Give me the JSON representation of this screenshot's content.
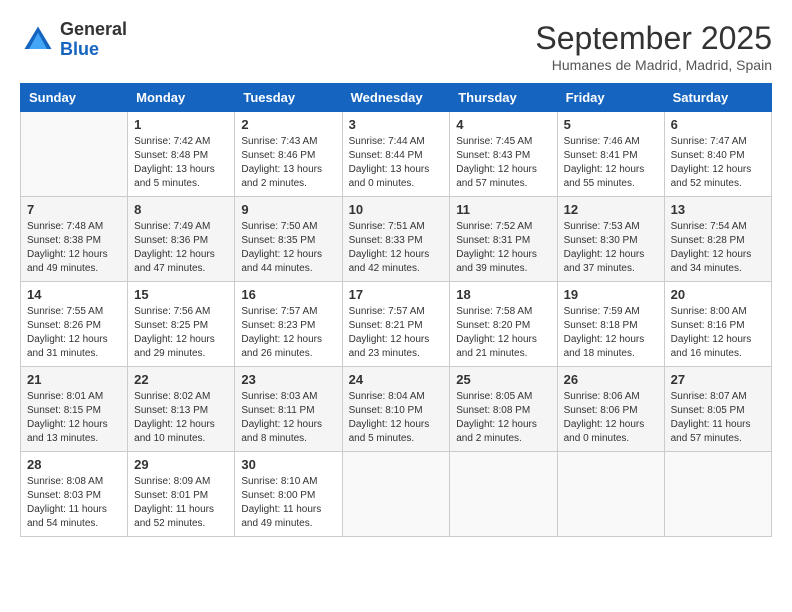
{
  "header": {
    "logo_line1": "General",
    "logo_line2": "Blue",
    "month_title": "September 2025",
    "location": "Humanes de Madrid, Madrid, Spain"
  },
  "days_of_week": [
    "Sunday",
    "Monday",
    "Tuesday",
    "Wednesday",
    "Thursday",
    "Friday",
    "Saturday"
  ],
  "weeks": [
    [
      {
        "day": "",
        "info": ""
      },
      {
        "day": "1",
        "info": "Sunrise: 7:42 AM\nSunset: 8:48 PM\nDaylight: 13 hours\nand 5 minutes."
      },
      {
        "day": "2",
        "info": "Sunrise: 7:43 AM\nSunset: 8:46 PM\nDaylight: 13 hours\nand 2 minutes."
      },
      {
        "day": "3",
        "info": "Sunrise: 7:44 AM\nSunset: 8:44 PM\nDaylight: 13 hours\nand 0 minutes."
      },
      {
        "day": "4",
        "info": "Sunrise: 7:45 AM\nSunset: 8:43 PM\nDaylight: 12 hours\nand 57 minutes."
      },
      {
        "day": "5",
        "info": "Sunrise: 7:46 AM\nSunset: 8:41 PM\nDaylight: 12 hours\nand 55 minutes."
      },
      {
        "day": "6",
        "info": "Sunrise: 7:47 AM\nSunset: 8:40 PM\nDaylight: 12 hours\nand 52 minutes."
      }
    ],
    [
      {
        "day": "7",
        "info": "Sunrise: 7:48 AM\nSunset: 8:38 PM\nDaylight: 12 hours\nand 49 minutes."
      },
      {
        "day": "8",
        "info": "Sunrise: 7:49 AM\nSunset: 8:36 PM\nDaylight: 12 hours\nand 47 minutes."
      },
      {
        "day": "9",
        "info": "Sunrise: 7:50 AM\nSunset: 8:35 PM\nDaylight: 12 hours\nand 44 minutes."
      },
      {
        "day": "10",
        "info": "Sunrise: 7:51 AM\nSunset: 8:33 PM\nDaylight: 12 hours\nand 42 minutes."
      },
      {
        "day": "11",
        "info": "Sunrise: 7:52 AM\nSunset: 8:31 PM\nDaylight: 12 hours\nand 39 minutes."
      },
      {
        "day": "12",
        "info": "Sunrise: 7:53 AM\nSunset: 8:30 PM\nDaylight: 12 hours\nand 37 minutes."
      },
      {
        "day": "13",
        "info": "Sunrise: 7:54 AM\nSunset: 8:28 PM\nDaylight: 12 hours\nand 34 minutes."
      }
    ],
    [
      {
        "day": "14",
        "info": "Sunrise: 7:55 AM\nSunset: 8:26 PM\nDaylight: 12 hours\nand 31 minutes."
      },
      {
        "day": "15",
        "info": "Sunrise: 7:56 AM\nSunset: 8:25 PM\nDaylight: 12 hours\nand 29 minutes."
      },
      {
        "day": "16",
        "info": "Sunrise: 7:57 AM\nSunset: 8:23 PM\nDaylight: 12 hours\nand 26 minutes."
      },
      {
        "day": "17",
        "info": "Sunrise: 7:57 AM\nSunset: 8:21 PM\nDaylight: 12 hours\nand 23 minutes."
      },
      {
        "day": "18",
        "info": "Sunrise: 7:58 AM\nSunset: 8:20 PM\nDaylight: 12 hours\nand 21 minutes."
      },
      {
        "day": "19",
        "info": "Sunrise: 7:59 AM\nSunset: 8:18 PM\nDaylight: 12 hours\nand 18 minutes."
      },
      {
        "day": "20",
        "info": "Sunrise: 8:00 AM\nSunset: 8:16 PM\nDaylight: 12 hours\nand 16 minutes."
      }
    ],
    [
      {
        "day": "21",
        "info": "Sunrise: 8:01 AM\nSunset: 8:15 PM\nDaylight: 12 hours\nand 13 minutes."
      },
      {
        "day": "22",
        "info": "Sunrise: 8:02 AM\nSunset: 8:13 PM\nDaylight: 12 hours\nand 10 minutes."
      },
      {
        "day": "23",
        "info": "Sunrise: 8:03 AM\nSunset: 8:11 PM\nDaylight: 12 hours\nand 8 minutes."
      },
      {
        "day": "24",
        "info": "Sunrise: 8:04 AM\nSunset: 8:10 PM\nDaylight: 12 hours\nand 5 minutes."
      },
      {
        "day": "25",
        "info": "Sunrise: 8:05 AM\nSunset: 8:08 PM\nDaylight: 12 hours\nand 2 minutes."
      },
      {
        "day": "26",
        "info": "Sunrise: 8:06 AM\nSunset: 8:06 PM\nDaylight: 12 hours\nand 0 minutes."
      },
      {
        "day": "27",
        "info": "Sunrise: 8:07 AM\nSunset: 8:05 PM\nDaylight: 11 hours\nand 57 minutes."
      }
    ],
    [
      {
        "day": "28",
        "info": "Sunrise: 8:08 AM\nSunset: 8:03 PM\nDaylight: 11 hours\nand 54 minutes."
      },
      {
        "day": "29",
        "info": "Sunrise: 8:09 AM\nSunset: 8:01 PM\nDaylight: 11 hours\nand 52 minutes."
      },
      {
        "day": "30",
        "info": "Sunrise: 8:10 AM\nSunset: 8:00 PM\nDaylight: 11 hours\nand 49 minutes."
      },
      {
        "day": "",
        "info": ""
      },
      {
        "day": "",
        "info": ""
      },
      {
        "day": "",
        "info": ""
      },
      {
        "day": "",
        "info": ""
      }
    ]
  ]
}
